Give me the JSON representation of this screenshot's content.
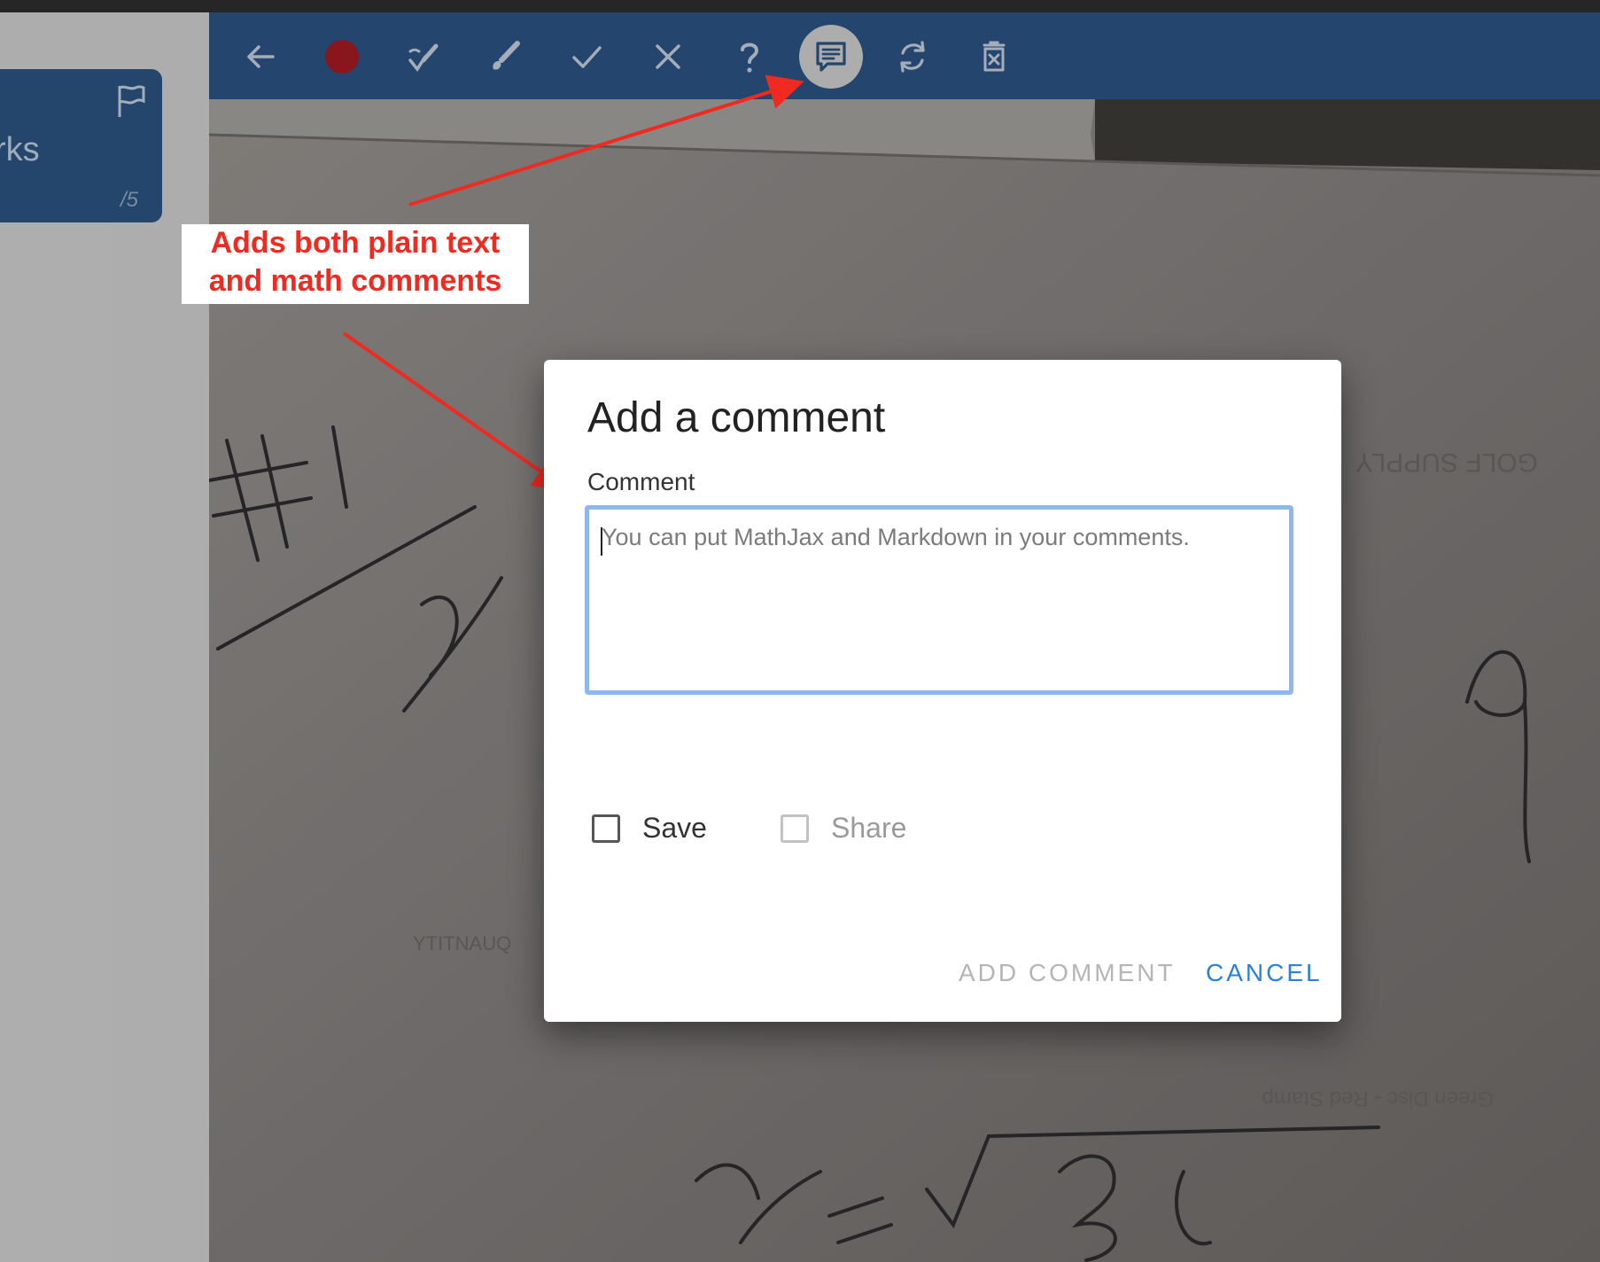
{
  "sidebar": {
    "card": {
      "title": "rks",
      "score": "/5",
      "flag_icon": "flag-icon"
    }
  },
  "toolbar": {
    "tools": [
      {
        "name": "back",
        "icon": "arrow-left-icon"
      },
      {
        "name": "record",
        "icon": "record-circle-icon",
        "color": "#a71b23"
      },
      {
        "name": "partial-check",
        "icon": "check-pencil-icon"
      },
      {
        "name": "brush",
        "icon": "brush-icon"
      },
      {
        "name": "check",
        "icon": "check-icon"
      },
      {
        "name": "cross",
        "icon": "cross-icon"
      },
      {
        "name": "question",
        "icon": "question-mark-icon"
      },
      {
        "name": "comment",
        "icon": "comment-icon",
        "active": true
      },
      {
        "name": "rotate",
        "icon": "rotate-icon"
      },
      {
        "name": "delete",
        "icon": "trash-icon"
      }
    ]
  },
  "annotation": {
    "line1": "Adds both plain text",
    "line2": "and math comments",
    "color": "#ef2a21"
  },
  "dialog": {
    "title": "Add a comment",
    "field_label": "Comment",
    "textarea_placeholder": "You can put MathJax and Markdown in your comments.",
    "textarea_value": "",
    "save_label": "Save",
    "save_checked": false,
    "share_label": "Share",
    "share_checked": false,
    "share_disabled": true,
    "add_button": "ADD COMMENT",
    "cancel_button": "CANCEL",
    "accent_color": "#2a81d6"
  },
  "colors": {
    "toolbar_bg": "#2c5585",
    "sidebar_card_bg": "#2d5686"
  }
}
